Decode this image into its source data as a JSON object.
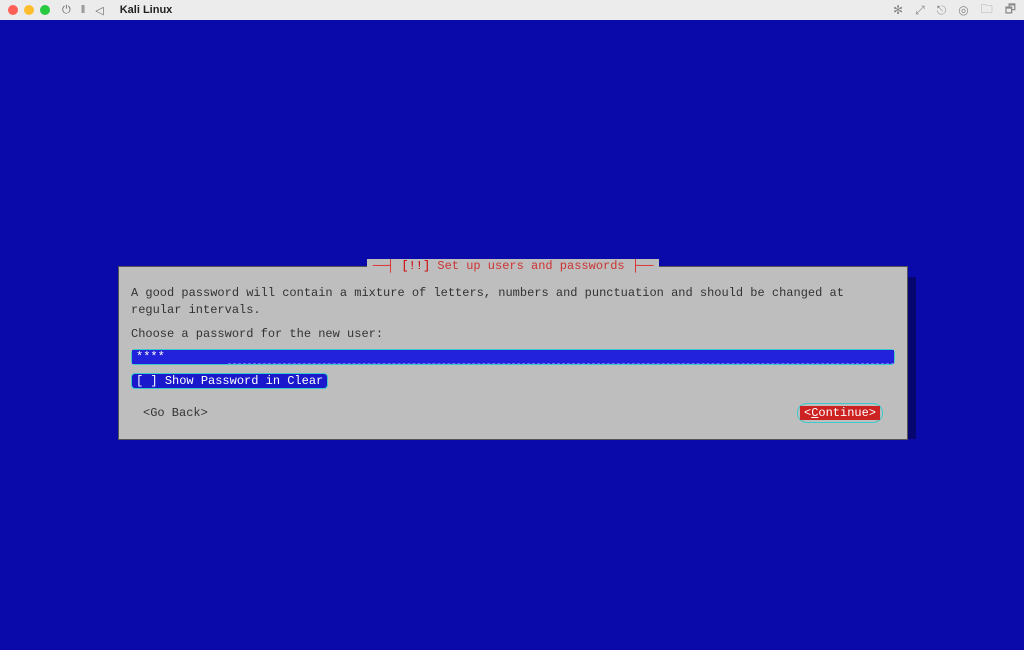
{
  "titlebar": {
    "vm_name": "Kali Linux"
  },
  "dialog": {
    "title_prefix": "[!!]",
    "title_text": "Set up users and passwords",
    "description": "A good password will contain a mixture of letters, numbers and punctuation and should be changed at regular intervals.",
    "prompt": "Choose a password for the new user:",
    "password_masked": "****",
    "show_password_checkbox_prefix": "[ ]",
    "show_password_label": "Show Password in Clear",
    "go_back_label": "<Go Back>",
    "continue_label_open": "<",
    "continue_hotkey": "C",
    "continue_rest": "ontinue>",
    "checkbox_checked": false
  }
}
